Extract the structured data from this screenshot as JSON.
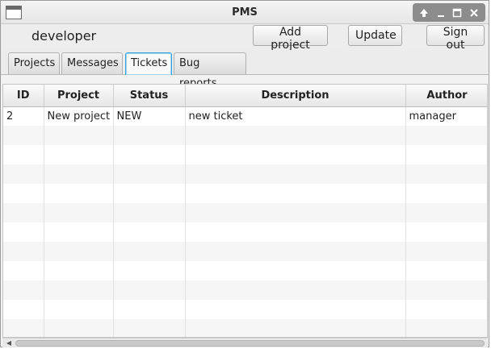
{
  "window": {
    "title": "PMS"
  },
  "toolbar": {
    "user": "developer",
    "add_project": "Add project",
    "update": "Update",
    "sign_out": "Sign out"
  },
  "tabs": [
    {
      "label": "Projects",
      "active": false
    },
    {
      "label": "Messages",
      "active": false
    },
    {
      "label": "Tickets",
      "active": true
    },
    {
      "label": "Bug reports",
      "active": false
    }
  ],
  "table": {
    "columns": [
      "ID",
      "Project",
      "Status",
      "Description",
      "Author"
    ],
    "rows": [
      [
        "2",
        "New project",
        "NEW",
        "new ticket",
        "manager"
      ]
    ],
    "empty_rows": 11
  },
  "icons": {
    "app": "window-icon",
    "wm": [
      "up-arrow-icon",
      "minimize-icon",
      "maximize-icon",
      "close-icon"
    ]
  }
}
